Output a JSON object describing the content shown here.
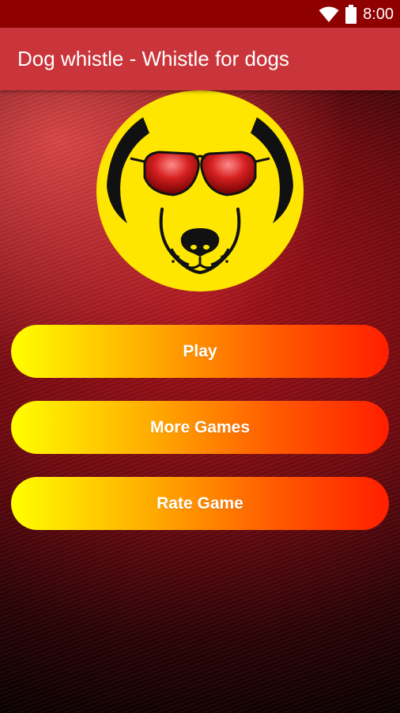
{
  "status_bar": {
    "time": "8:00",
    "icons": [
      "wifi-icon",
      "battery-icon"
    ]
  },
  "app_bar": {
    "title": "Dog whistle - Whistle for dogs"
  },
  "logo": {
    "icon": "dog-with-sunglasses-logo",
    "colors": {
      "face": "#ffe600",
      "glasses": "#d62020"
    }
  },
  "menu": {
    "play_label": "Play",
    "more_games_label": "More Games",
    "rate_game_label": "Rate Game"
  },
  "colors": {
    "status_bar": "#8f0000",
    "app_bar": "#c9353a",
    "button_gradient_start": "#ffff00",
    "button_gradient_end": "#ff1e00"
  }
}
